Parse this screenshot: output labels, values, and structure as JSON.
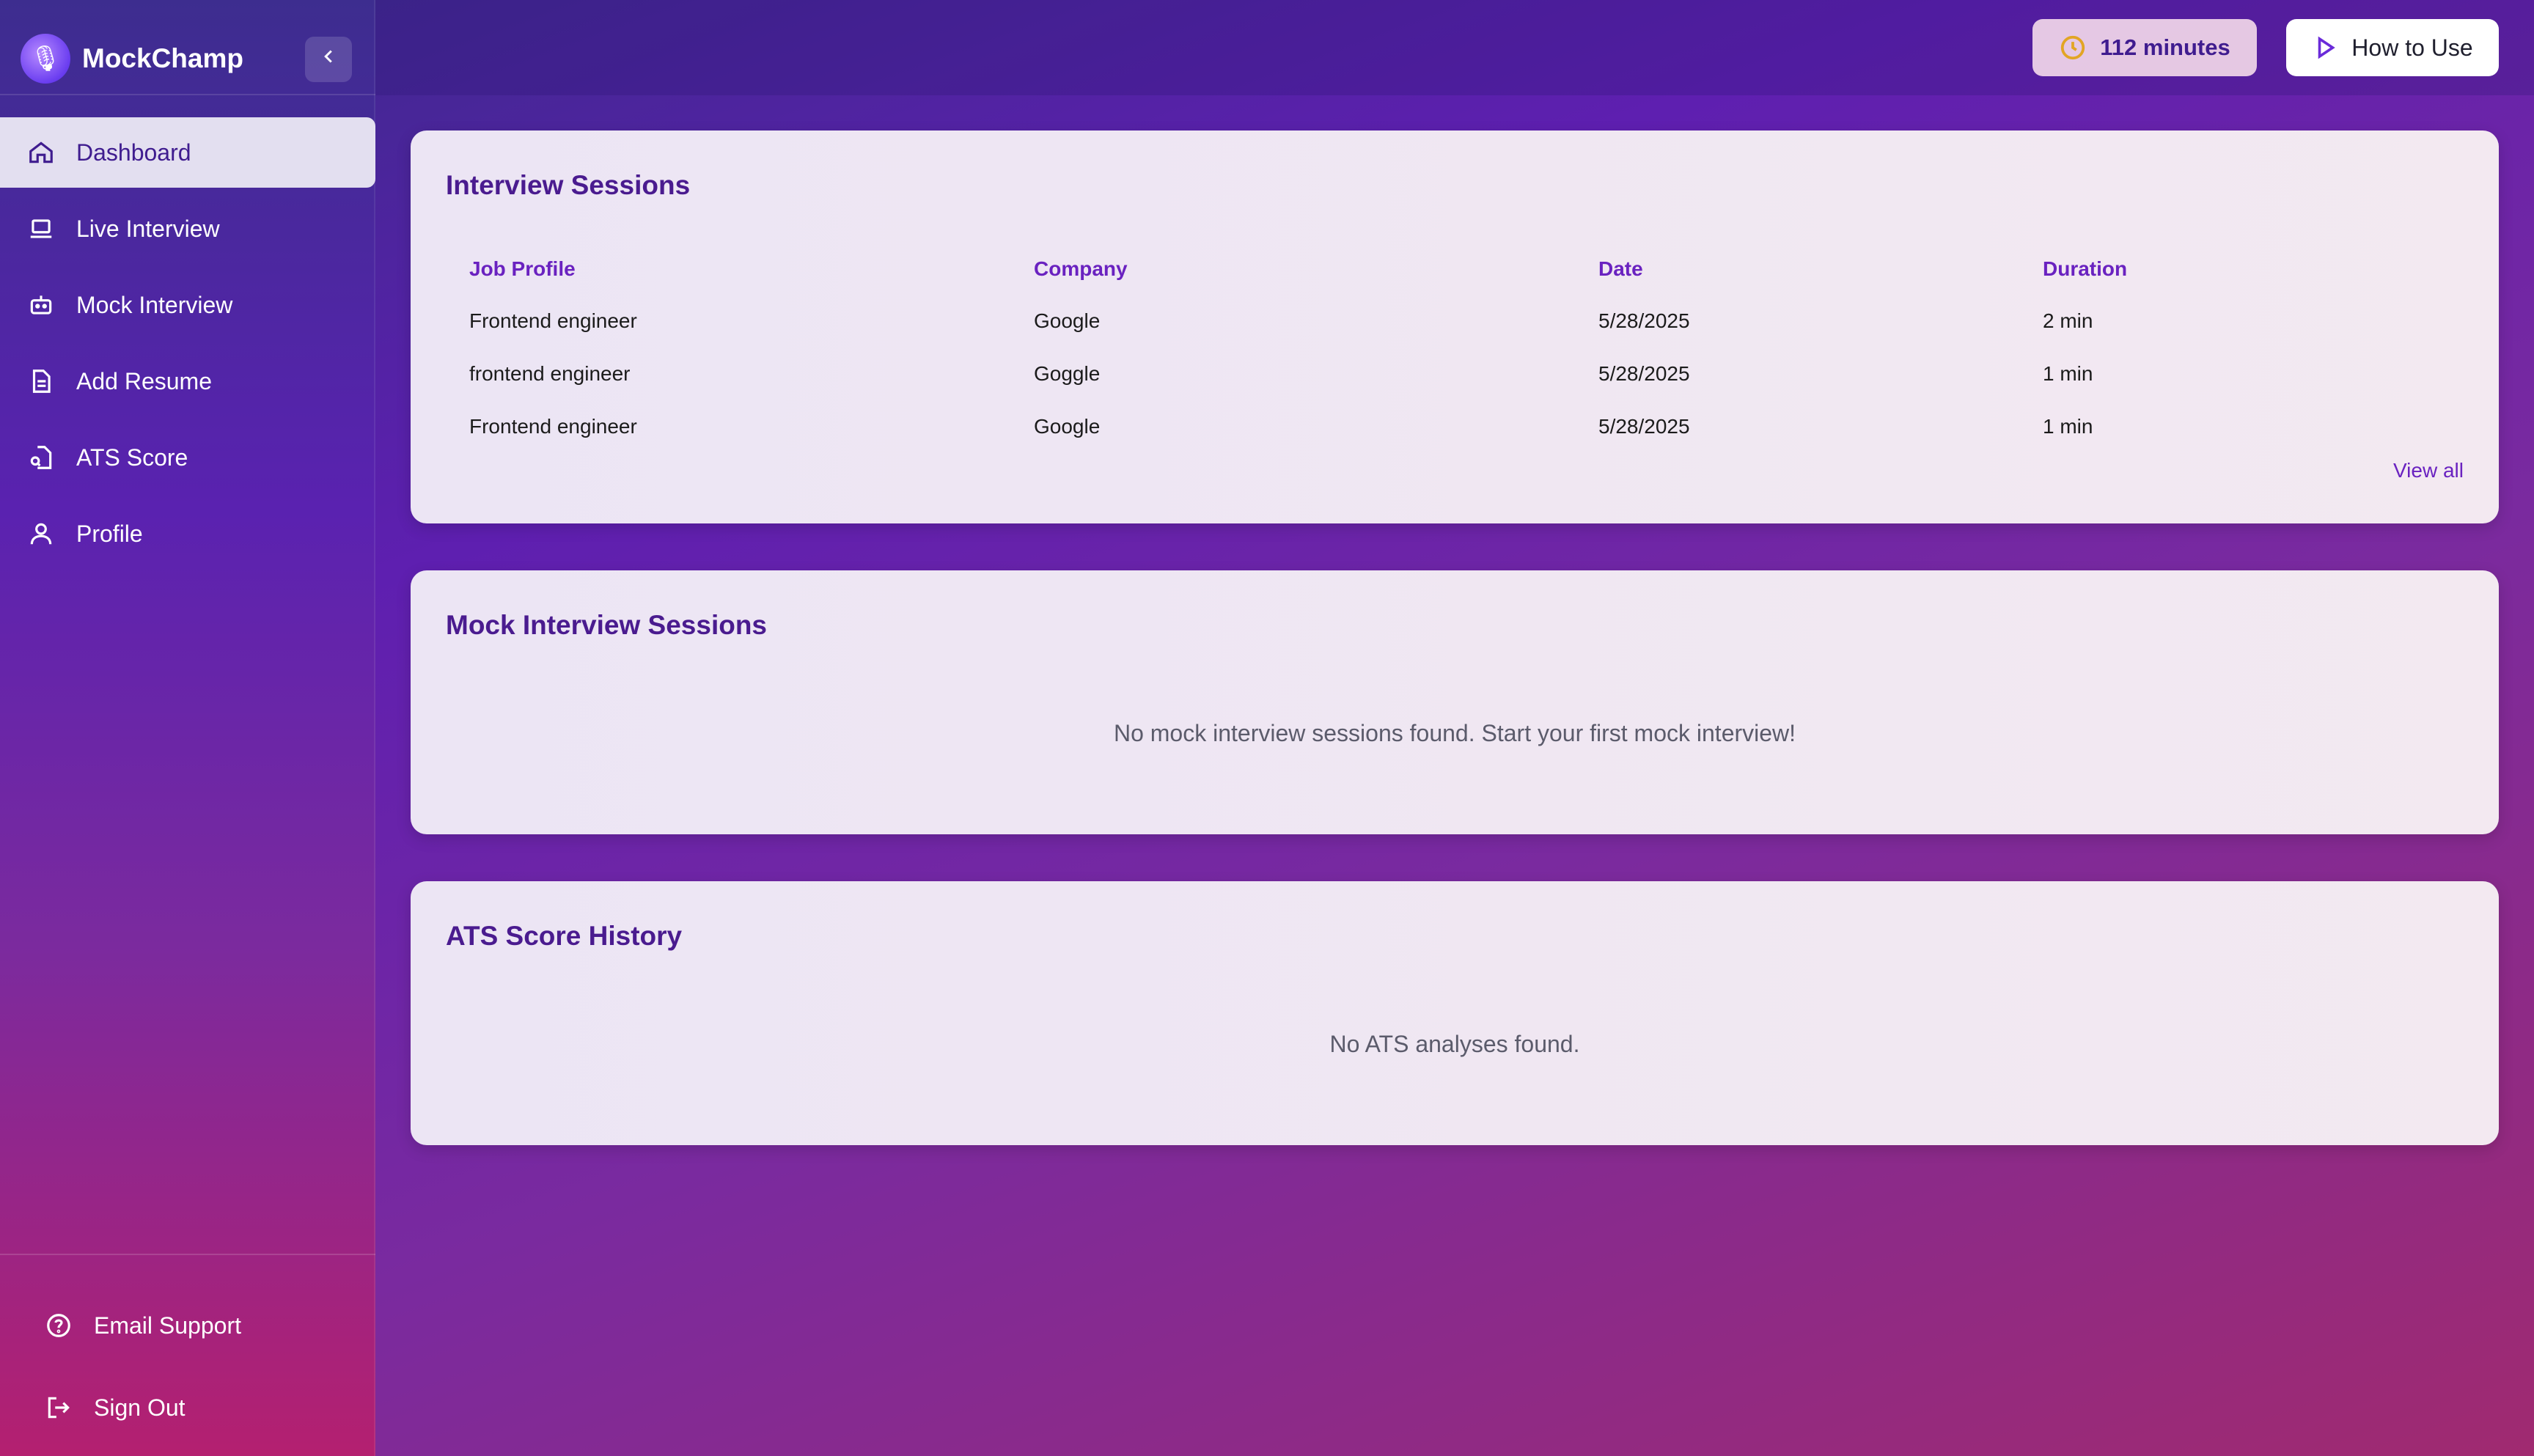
{
  "app": {
    "name": "MockChamp",
    "collapse_icon": "chevron-left-icon"
  },
  "sidebar": {
    "items": [
      {
        "label": "Dashboard",
        "icon": "home-icon",
        "active": true
      },
      {
        "label": "Live Interview",
        "icon": "laptop-icon"
      },
      {
        "label": "Mock Interview",
        "icon": "robot-icon"
      },
      {
        "label": "Add Resume",
        "icon": "document-icon"
      },
      {
        "label": "ATS Score",
        "icon": "file-search-icon"
      },
      {
        "label": "Profile",
        "icon": "user-icon"
      }
    ],
    "bottom": [
      {
        "label": "Email Support",
        "icon": "help-circle-icon"
      },
      {
        "label": "Sign Out",
        "icon": "sign-out-icon"
      }
    ]
  },
  "topbar": {
    "minutes": "112 minutes",
    "how_to_use": "How to Use"
  },
  "interview_sessions": {
    "title": "Interview Sessions",
    "columns": [
      "Job Profile",
      "Company",
      "Date",
      "Duration"
    ],
    "rows": [
      [
        "Frontend engineer",
        "Google",
        "5/28/2025",
        "2 min"
      ],
      [
        "frontend engineer",
        "Goggle",
        "5/28/2025",
        "1 min"
      ],
      [
        "Frontend engineer",
        "Google",
        "5/28/2025",
        "1 min"
      ]
    ],
    "view_all": "View all"
  },
  "mock_sessions": {
    "title": "Mock Interview Sessions",
    "empty": "No mock interview sessions found. Start your first mock interview!"
  },
  "ats_history": {
    "title": "ATS Score History",
    "empty": "No ATS analyses found."
  },
  "colors": {
    "accent": "#6a22c0",
    "title": "#4a1b8f",
    "clock": "#e2a524"
  }
}
